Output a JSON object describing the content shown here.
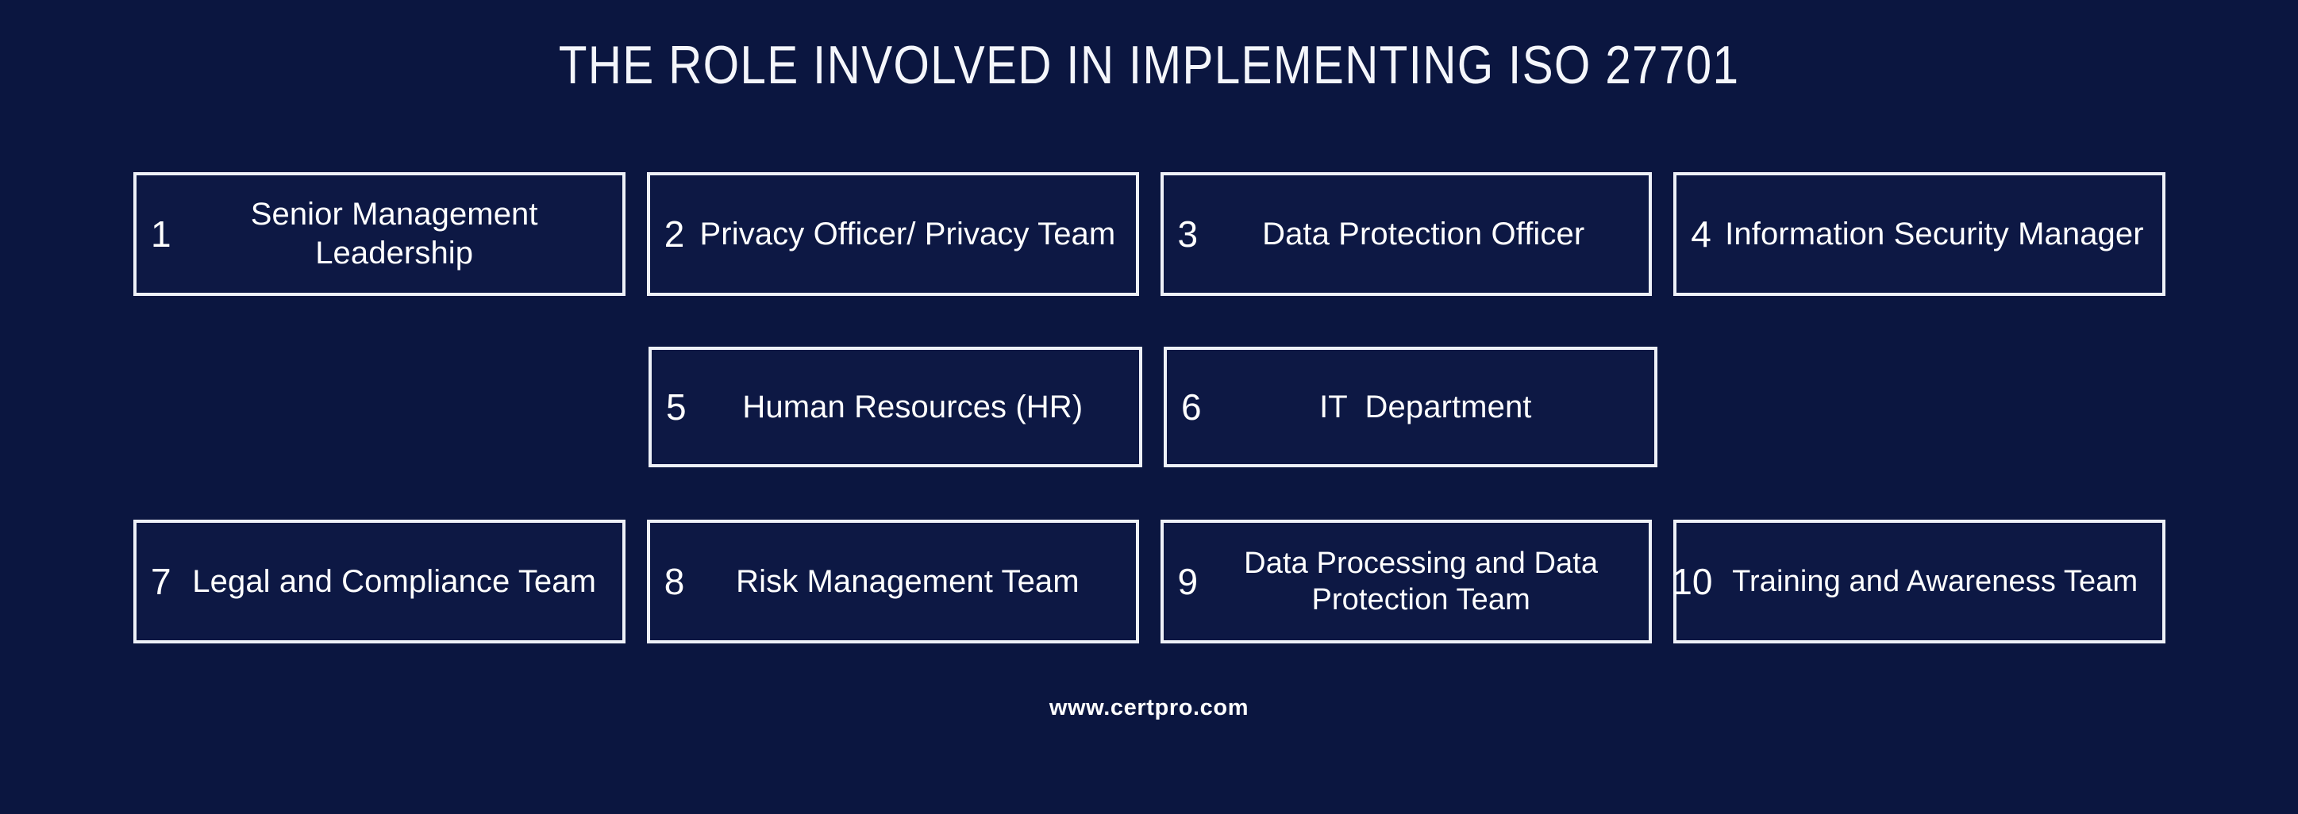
{
  "theme": {
    "background": "#0b1640",
    "box_fill": "#0d1844",
    "box_border": "#eef1f8",
    "text": "#ffffff"
  },
  "header": {
    "title": "THE ROLE INVOLVED IN IMPLEMENTING ISO 27701"
  },
  "roles": {
    "row1": [
      {
        "number": "1",
        "label": "Senior Management Leadership"
      },
      {
        "number": "2",
        "label": "Privacy Officer/ Privacy Team"
      },
      {
        "number": "3",
        "label": "Data Protection Officer"
      },
      {
        "number": "4",
        "label": "Information Security Manager"
      }
    ],
    "row2": [
      {
        "number": "5",
        "label": "Human Resources (HR)"
      },
      {
        "number": "6",
        "label": "IT  Department"
      }
    ],
    "row3": [
      {
        "number": "7",
        "label": "Legal and Compliance Team"
      },
      {
        "number": "8",
        "label": "Risk Management Team"
      },
      {
        "number": "9",
        "label": "Data Processing and Data Protection Team"
      },
      {
        "number": "10",
        "label": "Training and Awareness Team"
      }
    ]
  },
  "footer": {
    "website": "www.certpro.com"
  }
}
